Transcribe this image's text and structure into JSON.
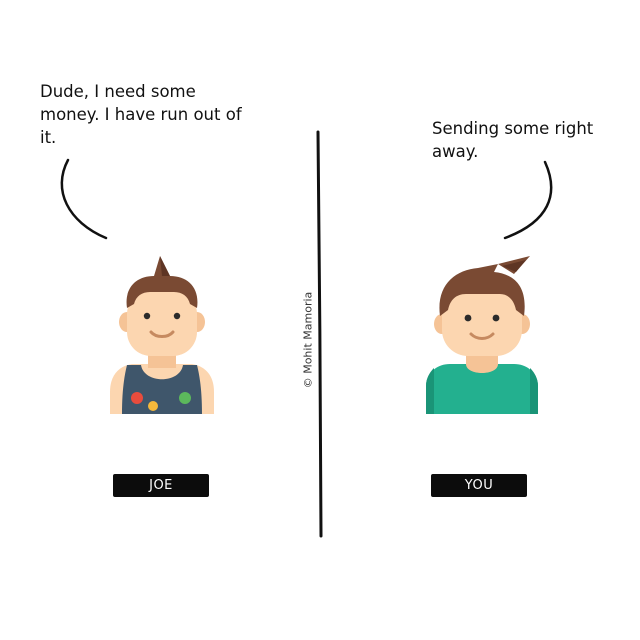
{
  "panel": {
    "left": {
      "speech": "Dude, I need some money. I have run out of it.",
      "name": "JOE"
    },
    "right": {
      "speech": "Sending some right away.",
      "name": "YOU"
    },
    "credit": "© Mohit Mamoria"
  },
  "colors": {
    "skin": "#fcd6b0",
    "skin_shadow": "#f5c396",
    "hair": "#7a4a33",
    "hair_dark": "#5e3524",
    "tank_top": "#3f566b",
    "shirt": "#23b08f",
    "shirt_dark": "#1a9477",
    "name_tag_bg": "#0c0c0c",
    "badge_red": "#e84c3d",
    "badge_yellow": "#f6b93b",
    "badge_green": "#5cb85c"
  }
}
